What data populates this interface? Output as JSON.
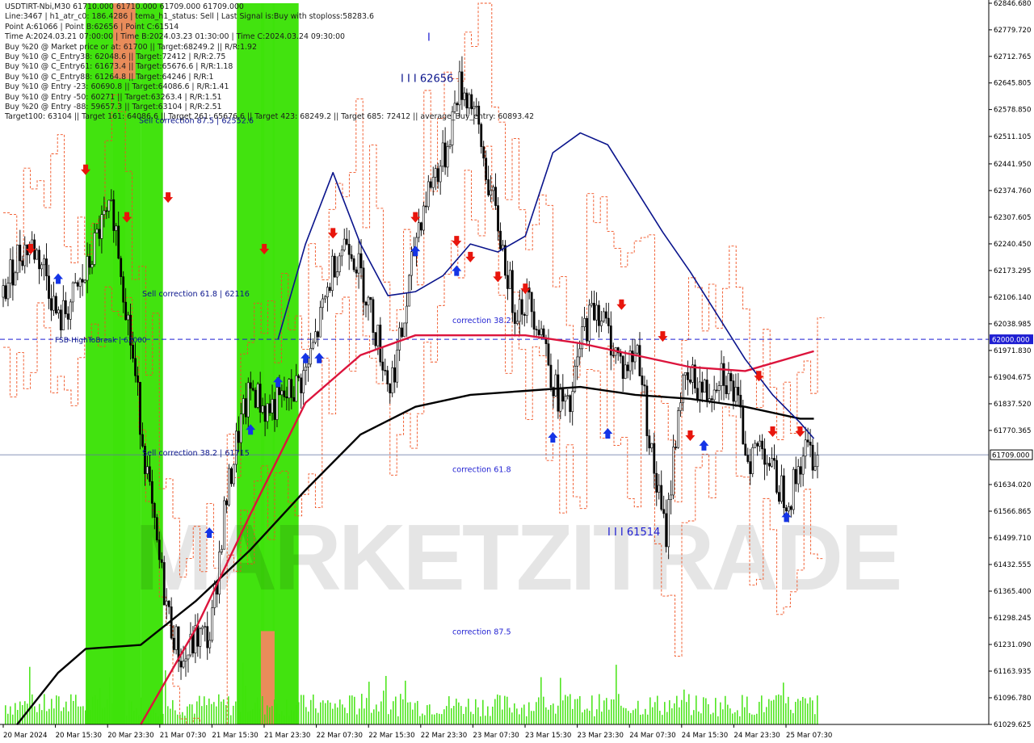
{
  "info_lines": [
    "USDTIRT-Nbi,M30  61710.000 61710.000 61709.000 61709.000",
    "Line:3467 | h1_atr_c0: 186.4286 | tema_h1_status: Sell | Last Signal is:Buy with stoploss:58283.6",
    "Point A:61066 | Point B:62656 | Point C:61514",
    "Time A:2024.03.21 07:00:00 | Time B:2024.03.23 01:30:00 | Time C:2024.03.24 09:30:00",
    "Buy %20 @ Market price or at: 61700 || Target:68249.2 || R/R:1.92",
    "Buy %10 @ C_Entry38: 62048.6 || Target:72412 | R/R:2.75",
    "Buy %10 @ C_Entry61: 61673.4 || Target:65676.6 | R/R:1.18",
    "Buy %10 @ C_Entry88: 61264.8 || Target:64246 | R/R:1",
    "Buy %10 @ Entry -23: 60690.8 || Target:64086.6 | R/R:1.41",
    "Buy %10 @ Entry -50: 60271 || Target:63263.4 | R/R:1.51",
    "Buy %20 @ Entry -88: 59657.3 || Target:63104 | R/R:2.51",
    "Target100: 63104 || Target 161: 64086.6 || Target 261: 65676.6 || Target 423: 68249.2 || Target 685: 72412 || average_Buy_entry: 60893.42"
  ],
  "watermark": "MARKETZITRADE",
  "colors": {
    "green_zone": "#3ee20a",
    "orange_zone": "#e98c5a",
    "ma_navy": "#0a148c",
    "ma_crimson": "#dc143c",
    "ma_black": "#000000",
    "candle": "#000000",
    "dashed_orange": "#f05020",
    "hline_blue": "#1e1ed2",
    "sell_arrow": "#e8150c",
    "buy_arrow": "#1434e6",
    "price_box": "#1e1ed2"
  },
  "chart_data": {
    "type": "candlestick",
    "symbol": "USDTIRT-Nbi",
    "timeframe": "M30",
    "y_axis": {
      "min": 61029.625,
      "max": 62846.68,
      "ticks": [
        "62846.680",
        "62779.720",
        "62712.765",
        "62645.805",
        "62578.850",
        "62511.105",
        "62441.950",
        "62374.760",
        "62307.605",
        "62240.450",
        "62173.295",
        "62106.140",
        "62038.985",
        "61971.830",
        "61904.675",
        "61837.520",
        "61770.365",
        "61709.000",
        "61634.020",
        "61566.865",
        "61499.710",
        "61432.555",
        "61365.400",
        "61298.245",
        "61231.090",
        "61163.935",
        "61096.780",
        "61029.625"
      ]
    },
    "x_axis": {
      "labels": [
        "20 Mar 2024",
        "20 Mar 15:30",
        "20 Mar 23:30",
        "21 Mar 07:30",
        "21 Mar 15:30",
        "21 Mar 23:30",
        "22 Mar 07:30",
        "22 Mar 15:30",
        "22 Mar 23:30",
        "23 Mar 07:30",
        "23 Mar 15:30",
        "23 Mar 23:30",
        "24 Mar 07:30",
        "24 Mar 15:30",
        "24 Mar 23:30",
        "25 Mar 07:30"
      ]
    },
    "last_price": "61709.000",
    "highlight_level": "62000.000",
    "levels": {
      "hline": 62000,
      "current": 61709
    },
    "annotations": [
      {
        "text": "Sell correction 87.5 | 62552.6",
        "price": 62552.6
      },
      {
        "text": "Sell correction 61.8 | 62116",
        "price": 62116
      },
      {
        "text": "Sell correction 38.2 | 61715",
        "price": 61715
      },
      {
        "text": "FSB-HighToBreak | 62000",
        "price": 62000
      },
      {
        "text": "correction 38.2",
        "price": 62048.6
      },
      {
        "text": "correction 61.8",
        "price": 61673.4
      },
      {
        "text": "correction 87.5",
        "price": 61264.8
      },
      {
        "text": "I I I 62656",
        "price": 62656
      },
      {
        "text": "I I I 61514",
        "price": 61514
      },
      {
        "text": "I",
        "price": 62760
      }
    ],
    "zones": [
      {
        "start": "21 Mar 00:00",
        "end": "21 Mar 11:30",
        "color": "green"
      },
      {
        "start": "21 Mar 08:00",
        "end": "21 Mar 16:00",
        "color": "green"
      },
      {
        "start": "21 Mar 16:00",
        "end": "21 Mar 22:30",
        "color": "green"
      },
      {
        "start": "22 Mar 20:00",
        "end": "23 Mar 04:00",
        "color": "green"
      },
      {
        "start": "23 Mar 03:00",
        "end": "23 Mar 07:00",
        "color": "green"
      },
      {
        "start": "23 Mar 06:30",
        "end": "23 Mar 14:00",
        "color": "green"
      }
    ],
    "orange_zones": [
      {
        "start": "21 Mar 08:00",
        "end": "21 Mar 14:30",
        "from_price": 62846.68,
        "to_price": 62656
      },
      {
        "start": "23 Mar 03:00",
        "end": "23 Mar 07:00",
        "from_price": 61264.8,
        "to_price": 61029.625
      }
    ],
    "ma_navy": [
      [
        20,
        62000
      ],
      [
        22,
        62240
      ],
      [
        24,
        62420
      ],
      [
        26,
        62240
      ],
      [
        28,
        62110
      ],
      [
        30,
        62120
      ],
      [
        32,
        62160
      ],
      [
        34,
        62240
      ],
      [
        36,
        62220
      ],
      [
        38,
        62260
      ],
      [
        40,
        62470
      ],
      [
        42,
        62520
      ],
      [
        44,
        62490
      ],
      [
        46,
        62380
      ],
      [
        48,
        62270
      ],
      [
        50,
        62170
      ],
      [
        52,
        62060
      ],
      [
        54,
        61950
      ],
      [
        56,
        61860
      ],
      [
        58,
        61790
      ],
      [
        59,
        61750
      ]
    ],
    "ma_crimson": [
      [
        10,
        61029
      ],
      [
        14,
        61270
      ],
      [
        18,
        61560
      ],
      [
        22,
        61840
      ],
      [
        26,
        61960
      ],
      [
        30,
        62010
      ],
      [
        34,
        62010
      ],
      [
        38,
        62010
      ],
      [
        42,
        61990
      ],
      [
        46,
        61960
      ],
      [
        50,
        61930
      ],
      [
        54,
        61920
      ],
      [
        58,
        61960
      ],
      [
        59,
        61970
      ]
    ],
    "ma_black": [
      [
        1,
        61029
      ],
      [
        4,
        61160
      ],
      [
        6,
        61220
      ],
      [
        10,
        61230
      ],
      [
        14,
        61340
      ],
      [
        18,
        61470
      ],
      [
        22,
        61620
      ],
      [
        26,
        61760
      ],
      [
        30,
        61830
      ],
      [
        34,
        61860
      ],
      [
        38,
        61870
      ],
      [
        42,
        61880
      ],
      [
        46,
        61860
      ],
      [
        50,
        61850
      ],
      [
        54,
        61830
      ],
      [
        58,
        61800
      ],
      [
        59,
        61800
      ]
    ],
    "candles_close_path": [
      62106,
      62210,
      62240,
      62180,
      62040,
      62100,
      62160,
      62280,
      62320,
      62060,
      61780,
      61500,
      61300,
      61180,
      61250,
      61250,
      61560,
      61760,
      61880,
      61820,
      61840,
      61870,
      61920,
      62050,
      62200,
      62260,
      62150,
      62020,
      61880,
      62030,
      62280,
      62400,
      62460,
      62640,
      62600,
      62420,
      62260,
      62080,
      62100,
      62030,
      61870,
      61810,
      62020,
      62090,
      62000,
      61920,
      61980,
      61700,
      61500,
      61860,
      61900,
      61860,
      61930,
      61860,
      61700,
      61740,
      61640,
      61600,
      61720,
      61709
    ]
  }
}
